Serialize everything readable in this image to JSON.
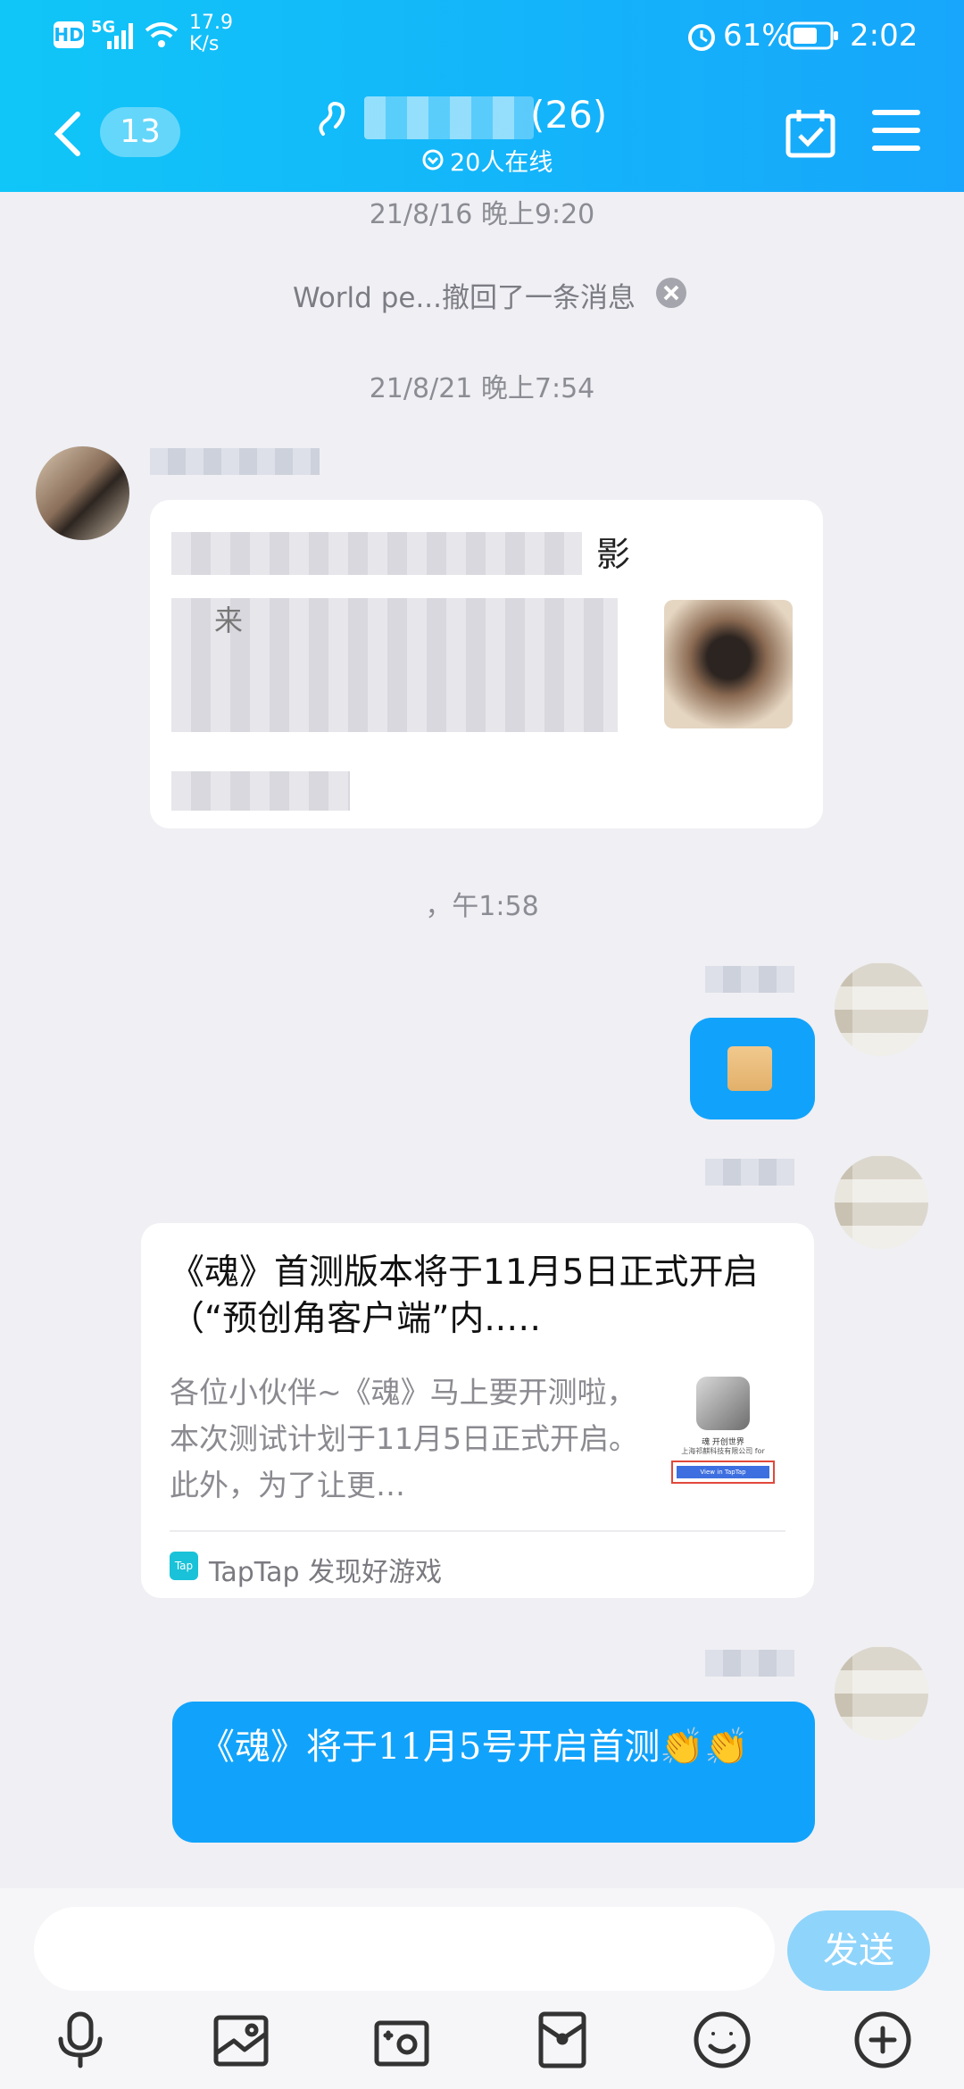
{
  "status_bar": {
    "hd": "HD",
    "net": "5G",
    "speed_top": "17.9",
    "speed_bottom": "K/s",
    "battery": "61%",
    "time": "2:02"
  },
  "header": {
    "back_count": "13",
    "member_count": "(26)",
    "online": "20人在线"
  },
  "chat": {
    "ts1": "21/8/16 晚上9:20",
    "recall": "World pe...撤回了一条消息",
    "ts2": "21/8/21 晚上7:54",
    "card1_title_char": "影",
    "card1_line_char": "来",
    "ts3": "，午1:58",
    "share": {
      "title": "《魂》首测版本将于11月5日正式开启（“预创角客户端”内..…",
      "desc": "各位小伙伴~《魂》马上要开测啦，本次测试计划于11月5日正式开启。此外，为了让更…",
      "thumb_line1": "魂 开创世界",
      "thumb_line2": "上海祁麒科技有限公司 for",
      "thumb_btn": "View in TapTap",
      "source_icon": "Tap",
      "source": "TapTap 发现好游戏"
    },
    "last_msg": "《魂》将于11月5号开启首测👏👏"
  },
  "input": {
    "placeholder": "",
    "send": "发送"
  },
  "toolbar": [
    "mic-icon",
    "image-icon",
    "camera-icon",
    "red-packet-icon",
    "emoji-icon",
    "plus-icon"
  ],
  "colors": {
    "header_start": "#10c6f8",
    "header_end": "#17a6fb",
    "bubble": "#11a3fb",
    "send_btn": "#8fd4fb"
  }
}
